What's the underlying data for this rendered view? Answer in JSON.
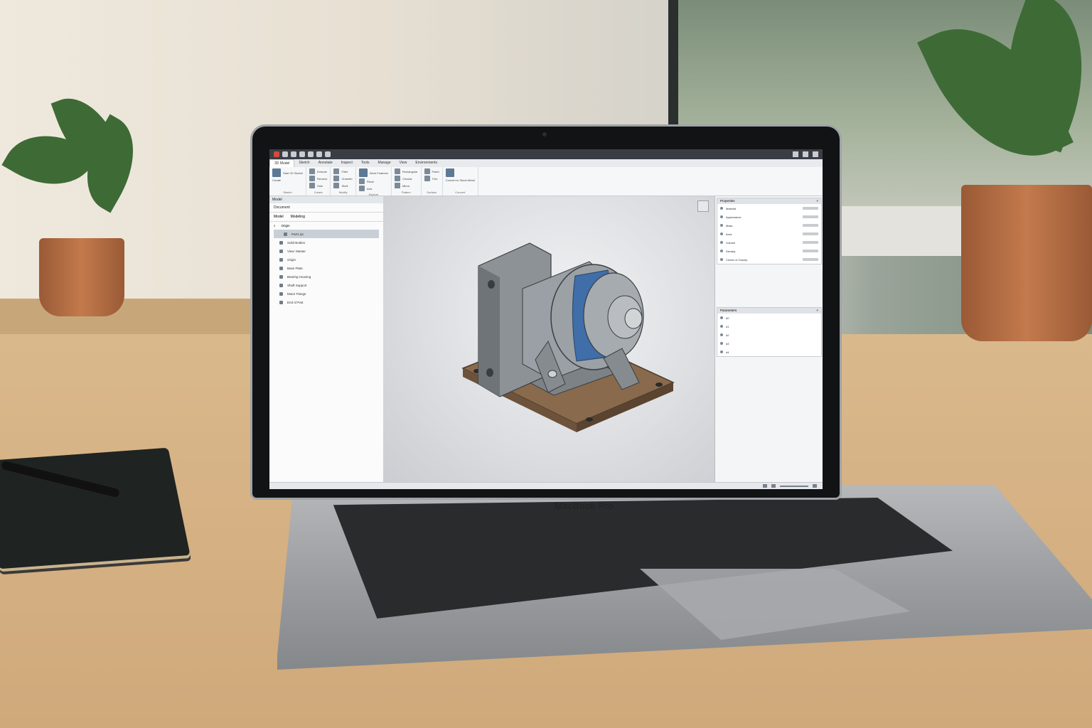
{
  "laptop": {
    "brand": "MacBook Pro"
  },
  "app": {
    "tabs": [
      "3D Model",
      "Sketch",
      "Annotate",
      "Inspect",
      "Tools",
      "Manage",
      "View",
      "Environments"
    ],
    "active_tab": "3D Model",
    "ribbon_groups": [
      {
        "title": "Sketch",
        "items": [
          "Start 2D Sketch",
          "Create"
        ]
      },
      {
        "title": "Create",
        "items": [
          "Extrude",
          "Revolve",
          "Hole"
        ]
      },
      {
        "title": "Modify",
        "items": [
          "Fillet",
          "Chamfer",
          "Shell"
        ]
      },
      {
        "title": "Explore",
        "items": [
          "Work Features",
          "Plane",
          "Axis"
        ]
      },
      {
        "title": "Pattern",
        "items": [
          "Rectangular",
          "Circular",
          "Mirror"
        ]
      },
      {
        "title": "Surface",
        "items": [
          "Patch",
          "Trim"
        ]
      },
      {
        "title": "Convert",
        "items": [
          "Convert to Sheet Metal"
        ]
      }
    ],
    "browser": {
      "header": "Model",
      "title": "Document",
      "tabs": [
        "Model",
        "Modeling"
      ],
      "search_label": "Origin",
      "items": [
        "Part1.ipt",
        "Solid Bodies",
        "View: Master",
        "Origin",
        "Base Plate",
        "Bearing Housing",
        "Shaft Support",
        "Motor Flange",
        "End of Part"
      ]
    },
    "props": {
      "panel1_title": "Properties",
      "panel1_rows": [
        "Material",
        "Appearance",
        "Mass",
        "Area",
        "Volume",
        "Density",
        "Center of Gravity"
      ],
      "panel2_title": "Parameters",
      "panel2_rows": [
        "d0",
        "d1",
        "d2",
        "d3",
        "d4"
      ]
    }
  },
  "colors": {
    "motor_band": "#3f6ea8",
    "base_plate": "#8a6a4c",
    "housing": "#8c9196"
  },
  "icons": [
    "save-icon",
    "undo-icon",
    "redo-icon",
    "search-icon",
    "close-icon",
    "view-cube-icon"
  ]
}
